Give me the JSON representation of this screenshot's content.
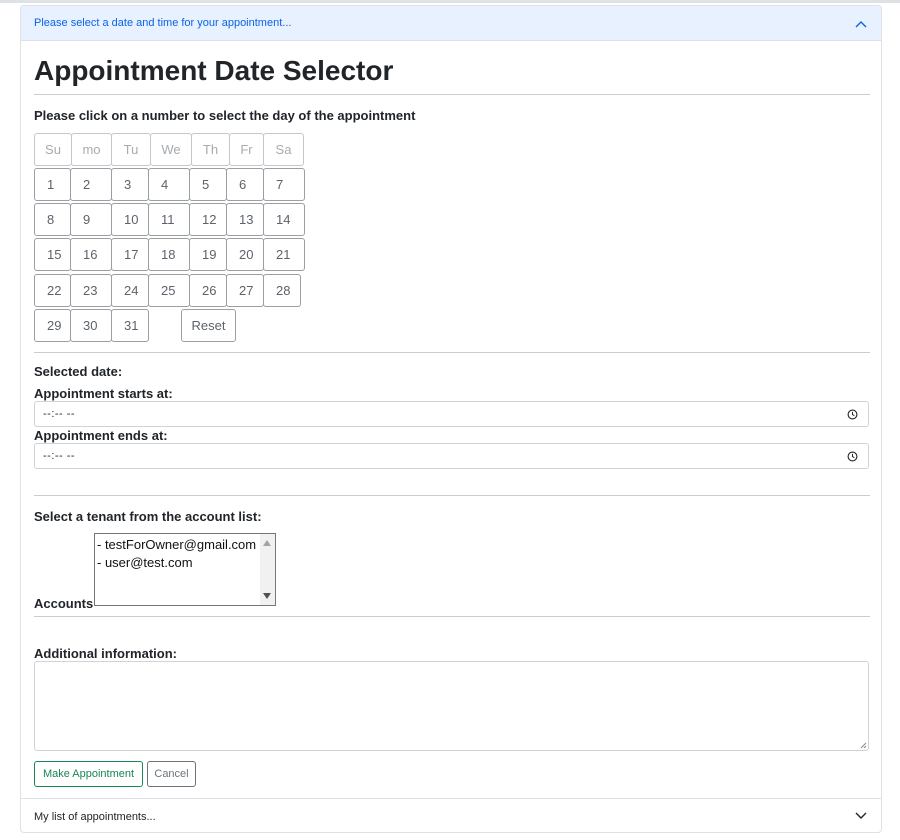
{
  "top_accordion": {
    "title": "Please select a date and time for your appointment...",
    "expanded": true,
    "icon": "chevron-up-icon"
  },
  "page_title": "Appointment Date Selector",
  "calendar": {
    "instruction": "Please click on a number to select the day of the appointment",
    "weekday_headers": [
      "Su",
      "mo",
      "Tu",
      "We",
      "Th",
      "Fr",
      "Sa"
    ],
    "days": [
      "1",
      "2",
      "3",
      "4",
      "5",
      "6",
      "7",
      "8",
      "9",
      "10",
      "11",
      "12",
      "13",
      "14",
      "15",
      "16",
      "17",
      "18",
      "19",
      "20",
      "21",
      "22",
      "23",
      "24",
      "25",
      "26",
      "27",
      "28",
      "29",
      "30",
      "31"
    ],
    "reset_label": "Reset"
  },
  "time": {
    "selected_date_label": "Selected date:",
    "selected_date_value": "",
    "start_label": "Appointment starts at:",
    "start_value": "--:-- --",
    "end_label": "Appointment ends at:",
    "end_value": "--:-- --",
    "icon": "clock-icon"
  },
  "tenant": {
    "heading": "Select a tenant from the account list:",
    "accounts_label": "Accounts",
    "options": [
      "- testForOwner@gmail.com",
      "- user@test.com"
    ]
  },
  "additional": {
    "label": "Additional information:",
    "value": ""
  },
  "buttons": {
    "make_label": "Make Appointment",
    "cancel_label": "Cancel"
  },
  "bottom_accordion": {
    "title": "My list of appointments...",
    "expanded": false,
    "icon": "chevron-down-icon"
  },
  "colors": {
    "header_bg": "#e7f1ff",
    "header_text": "#0c63e4",
    "success": "#198754",
    "secondary": "#6c757d"
  }
}
